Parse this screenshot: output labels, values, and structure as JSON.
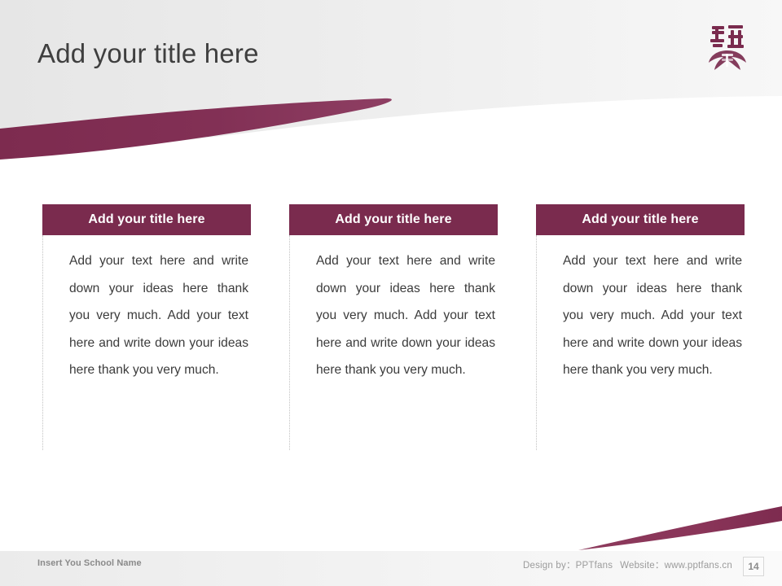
{
  "slide": {
    "title": "Add your title here",
    "page_number": "14",
    "accent_color": "#7A2B4E",
    "title_color": "#3F3F3F",
    "body_text_color": "#3B3B3B",
    "header_band_color": "#E9E9E9"
  },
  "logo": {
    "name": "school-emblem",
    "characters": "经",
    "sub_characters": "市",
    "color": "#7A2B4E"
  },
  "columns": [
    {
      "title": "Add your title here",
      "body": "Add your text here and write down your ideas here thank you very much. Add your text here and write down your ideas here thank you very much."
    },
    {
      "title": "Add your title here",
      "body": "Add your text here and write down your ideas here thank you very much. Add your text here and write down your ideas here thank you very much."
    },
    {
      "title": "Add your title here",
      "body": "Add your text here and write down your ideas here thank you very much. Add your text here and write down your ideas here thank you very much."
    }
  ],
  "footer": {
    "school_name": "Insert You School Name",
    "design_by_label": "Design by：PPTfans",
    "website_label": "Website：www.pptfans.cn"
  }
}
